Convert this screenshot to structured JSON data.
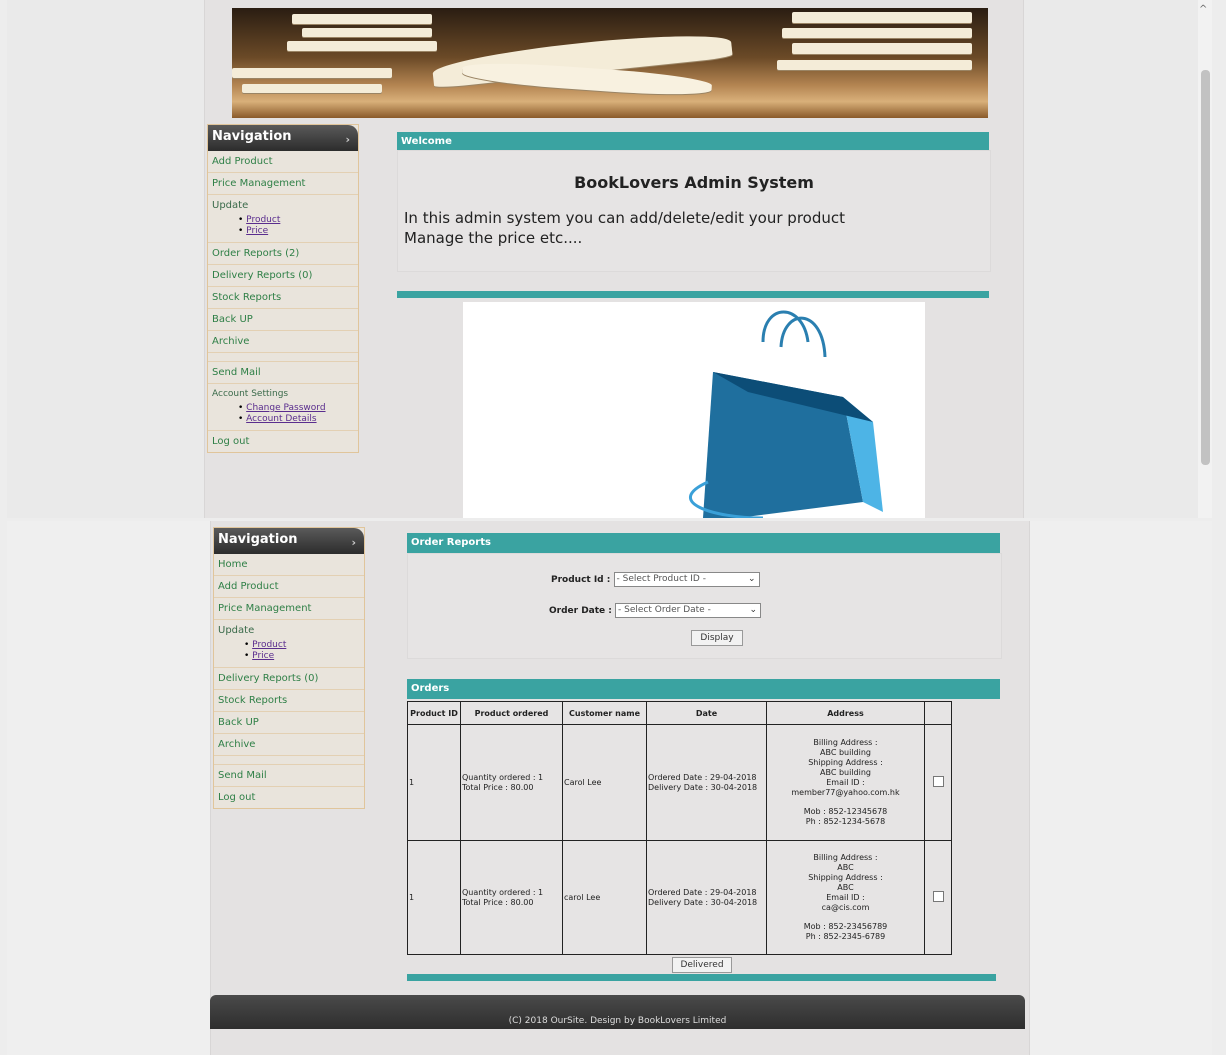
{
  "welcome_view": {
    "nav": {
      "title": "Navigation",
      "items": [
        {
          "label": "Add Product"
        },
        {
          "label": "Price Management"
        },
        {
          "label": "Update"
        },
        {
          "label": "Order Reports (2)"
        },
        {
          "label": "Delivery Reports (0)"
        },
        {
          "label": "Stock Reports"
        },
        {
          "label": "Back UP"
        },
        {
          "label": "Archive"
        },
        {
          "label": "Send Mail"
        },
        {
          "label": "Account Settings"
        },
        {
          "label": "Log out"
        }
      ],
      "update_sub": [
        "Product",
        "Price"
      ],
      "account_sub": [
        "Change Password",
        "Account Details"
      ]
    },
    "welcome_bar": "Welcome",
    "system_title": "BookLovers Admin System",
    "line1": "In this admin system you can add/delete/edit your product",
    "line2": "Manage the price etc...."
  },
  "orders_view": {
    "nav": {
      "title": "Navigation",
      "items": [
        {
          "label": "Home"
        },
        {
          "label": "Add Product"
        },
        {
          "label": "Price Management"
        },
        {
          "label": "Update"
        },
        {
          "label": "Delivery Reports (0)"
        },
        {
          "label": "Stock Reports"
        },
        {
          "label": "Back UP"
        },
        {
          "label": "Archive"
        },
        {
          "label": "Send Mail"
        },
        {
          "label": "Log out"
        }
      ],
      "update_sub": [
        "Product",
        "Price"
      ]
    },
    "order_reports_bar": "Order Reports",
    "product_id_label": "Product Id :",
    "product_id_select": "- Select Product ID -",
    "order_date_label": "Order Date :",
    "order_date_select": "- Select Order Date -",
    "display_button": "Display",
    "orders_bar": "Orders",
    "table": {
      "headers": [
        "Product ID",
        "Product ordered",
        "Customer name",
        "Date",
        "Address",
        ""
      ],
      "rows": [
        {
          "product_id": "1",
          "quantity": "Quantity ordered : 1",
          "total": "Total Price : 80.00",
          "customer": "Carol Lee",
          "ordered": "Ordered Date : 29-04-2018",
          "delivery": "Delivery Date : 30-04-2018",
          "addr": [
            "Billing Address :",
            "ABC building",
            "Shipping Address :",
            "ABC building",
            "Email ID :",
            "member77@yahoo.com.hk"
          ],
          "mob": "Mob : 852-12345678",
          "ph": "Ph : 852-1234-5678"
        },
        {
          "product_id": "1",
          "quantity": "Quantity ordered : 1",
          "total": "Total Price : 80.00",
          "customer": "carol Lee",
          "ordered": "Ordered Date : 29-04-2018",
          "delivery": "Delivery Date : 30-04-2018",
          "addr": [
            "Billing Address :",
            "ABC",
            "Shipping Address :",
            "ABC",
            "Email ID :",
            "ca@cis.com"
          ],
          "mob": "Mob : 852-23456789",
          "ph": "Ph : 852-2345-6789"
        }
      ]
    },
    "delivered_button": "Delivered",
    "footer": "(C) 2018 OurSite. Design by BookLovers Limited"
  }
}
